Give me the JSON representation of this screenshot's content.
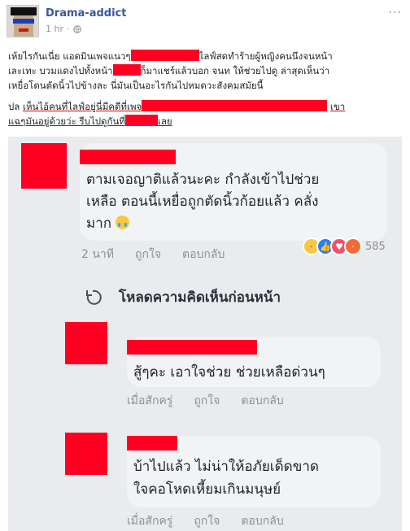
{
  "post": {
    "author": "Drama-addict",
    "time": "1 hr",
    "more": "···",
    "paragraph1": {
      "a": "เห้ยไรกันเนี่ย แอดมินเพจแนวๆ",
      "b": "ไลฟ์สดทำร้ายผู้หญิงคนนึงจนหน้า",
      "c": "เละเทะ บวมแดงไปทั้งหน้า",
      "d": "ก็มาแชร์แล้วบอก จนท ให้ช่วยไปดู ล่าสุดเห็นว่า",
      "e": "เหยื่อโดนตัดนิ้วไปข้างละ นี่มันเป็นอะไรกันไปหมดวะสังคมสมัยนี้"
    },
    "paragraph2": {
      "a": "ปล ",
      "b": "เห็นไอ้คนที่ไลฟ์อยู่นี่มีคดีที่เพจ",
      "c": "เขา",
      "d": "แฉๆมันอยู่ด้วยว่ะ รีบไปดูกันที่",
      "e": "เลย"
    }
  },
  "screenshot": {
    "comments": [
      {
        "text_line1": "ตามเจอญาติแล้วนะคะ กำลังเข้าไปช่วย",
        "text_line2": "เหลือ ตอนนี้เหยื่อถูกตัดนิ้วก้อยแล้ว คลั่ง",
        "text_line3": "มาก",
        "time": "2 นาที",
        "like": "ถูกใจ",
        "reply": "ตอบกลับ",
        "reaction_count": "585"
      },
      {
        "text_line1": "สู้ๆคะ เอาใจช่วย ช่วยเหลือด่วนๆ",
        "time": "เมื่อสักครู่",
        "like": "ถูกใจ",
        "reply": "ตอบกลับ"
      },
      {
        "text_line1": "บ้าไปแล้ว ไม่น่าให้อภัยเด็ดขาด",
        "text_line2": "ใจคอโหดเหี้ยมเกินมนุษย์",
        "time": "เมื่อสักครู่",
        "like": "ถูกใจ",
        "reply": "ตอบกลับ"
      }
    ],
    "load_previous": "โหลดความคิดเห็นก่อนหน้า"
  },
  "colors": {
    "author": "#385898",
    "redaction": "#ff0022",
    "meta": "#90949c",
    "screenshot_bg": "#e9ebee"
  },
  "icons": {
    "globe": "globe-icon",
    "reload": "reload-icon",
    "sad_emoji": "crying-face-icon",
    "like": "like-reaction-icon",
    "love": "love-reaction-icon",
    "angry": "angry-reaction-icon"
  }
}
